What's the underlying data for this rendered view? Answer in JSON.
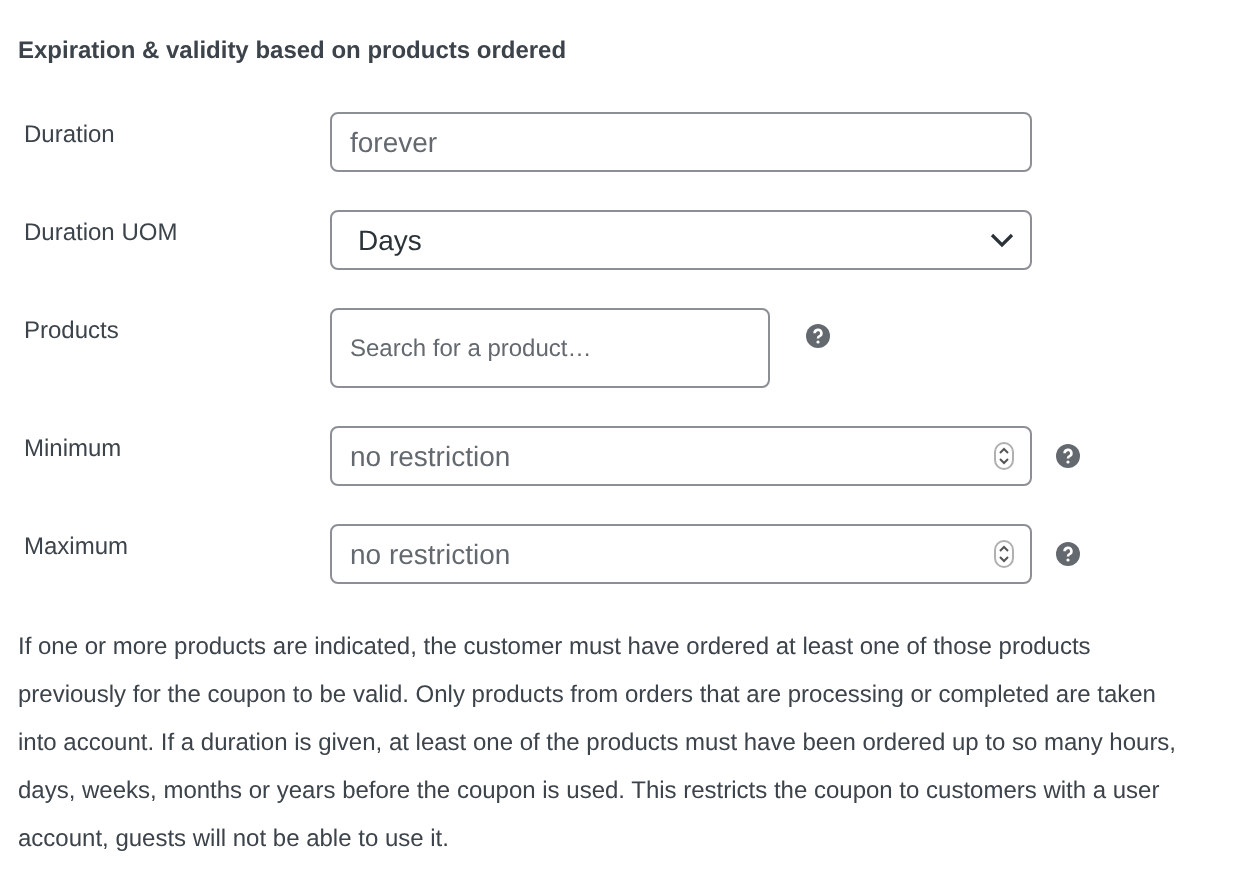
{
  "section_title": "Expiration & validity based on products ordered",
  "fields": [
    {
      "label": "Duration",
      "kind": "text",
      "placeholder": "forever",
      "help": false
    },
    {
      "label": "Duration UOM",
      "kind": "select",
      "value": "Days",
      "help": false
    },
    {
      "label": "Products",
      "kind": "search",
      "placeholder": "Search for a product…",
      "help": true
    },
    {
      "label": "Minimum",
      "kind": "number",
      "placeholder": "no restriction",
      "help": true
    },
    {
      "label": "Maximum",
      "kind": "number",
      "placeholder": "no restriction",
      "help": true
    }
  ],
  "description": "If one or more products are indicated, the customer must have ordered at least one of those products previously for the coupon to be valid. Only products from orders that are processing or completed are taken into account. If a duration is given, at least one of the products must have been ordered up to so many hours, days, weeks, months or years before the coupon is used. This restricts the coupon to customers with a user account, guests will not be able to use it."
}
